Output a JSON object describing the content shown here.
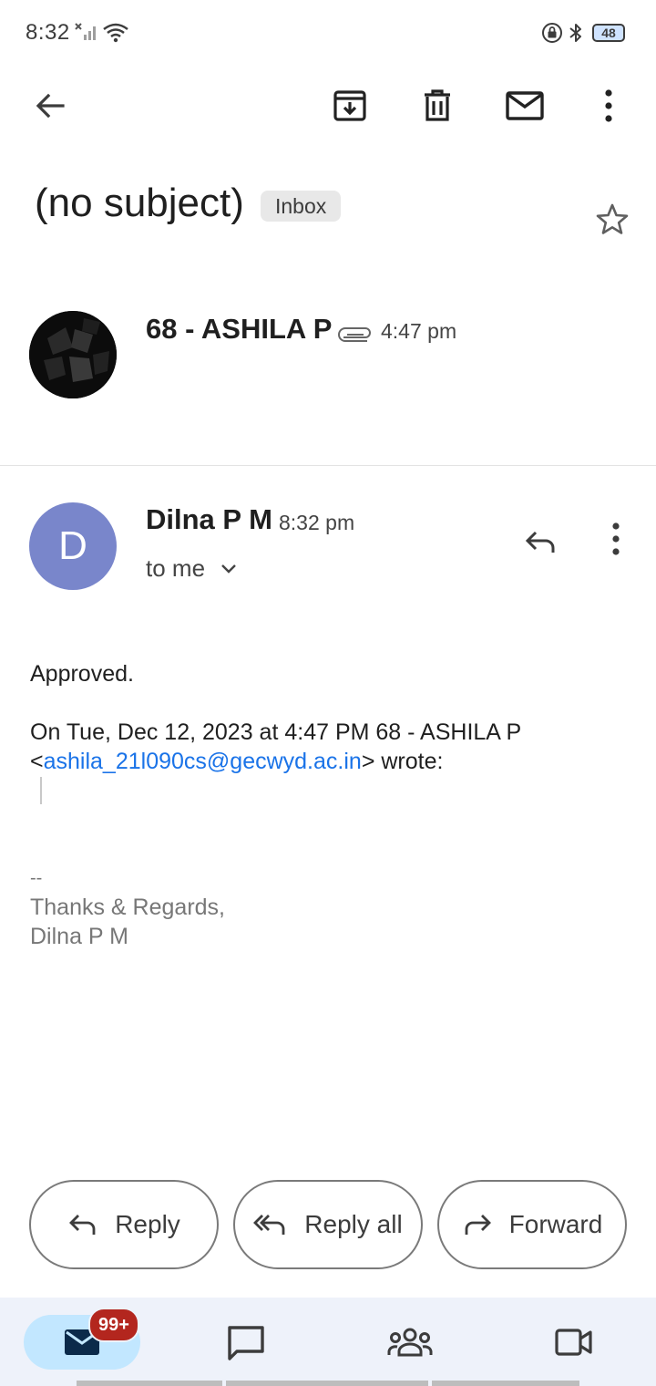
{
  "status_bar": {
    "time": "8:32",
    "battery": "48",
    "icons": [
      "signal-off-icon",
      "wifi-icon",
      "lock-icon",
      "bluetooth-icon",
      "battery-icon"
    ]
  },
  "toolbar": {
    "icons": [
      "back-arrow-icon",
      "archive-icon",
      "delete-icon",
      "mark-unread-icon",
      "more-vert-icon"
    ]
  },
  "thread": {
    "subject": "(no subject)",
    "label": "Inbox"
  },
  "messages": [
    {
      "sender": "68 - ASHILA P",
      "time": "4:47 pm",
      "has_attachment": true
    },
    {
      "sender": "Dilna P M",
      "avatar_letter": "D",
      "avatar_color": "#7986cb",
      "time": "8:32 pm",
      "recipient": "to me",
      "body": "Approved.",
      "quote_line1": "On Tue, Dec 12, 2023 at 4:47 PM 68 - ASHILA P",
      "quote_prefix": "<",
      "quote_email": "ashila_21l090cs@gecwyd.ac.in",
      "quote_suffix": "> wrote:",
      "signature_sep": "--",
      "signature_line1": "Thanks & Regards,",
      "signature_line2": "Dilna P M"
    }
  ],
  "actions": {
    "reply": "Reply",
    "reply_all": "Reply all",
    "forward": "Forward"
  },
  "bottom_nav": {
    "mail_badge": "99+",
    "items": [
      "mail-icon",
      "chat-icon",
      "spaces-icon",
      "meet-icon"
    ]
  },
  "colors": {
    "accent_link": "#1a73e8",
    "badge": "#b3261e",
    "nav_active": "#c2e7ff",
    "nav_bg": "#eef2fa"
  }
}
